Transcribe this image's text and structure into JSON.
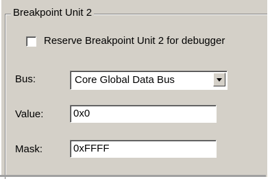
{
  "group": {
    "title": "Breakpoint Unit 2"
  },
  "reserve": {
    "label": "Reserve Breakpoint Unit 2 for debugger",
    "checked": false
  },
  "bus": {
    "label": "Bus:",
    "selected": "Core Global Data Bus"
  },
  "value": {
    "label": "Value:",
    "text": "0x0"
  },
  "mask": {
    "label": "Mask:",
    "text": "0xFFFF"
  }
}
